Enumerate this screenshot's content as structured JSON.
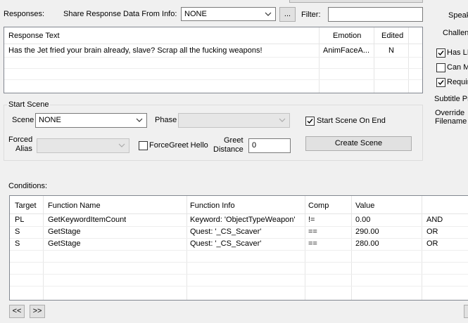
{
  "top": {
    "responses_label": "Responses:",
    "share_label": "Share Response Data From Info:",
    "share_value": "NONE",
    "ellipsis_label": "...",
    "filter_label": "Filter:",
    "filter_value": ""
  },
  "responses_table": {
    "columns": [
      "Response Text",
      "Emotion",
      "Edited"
    ],
    "rows": [
      {
        "text": "Has the Jet fried your brain already, slave? Scrap all the fucking weapons!",
        "emotion": "AnimFaceA...",
        "edited": "N"
      }
    ]
  },
  "start_scene": {
    "group_title": "Start Scene",
    "scene_label": "Scene",
    "scene_value": "NONE",
    "phase_label": "Phase",
    "phase_value": "",
    "start_scene_on_end_label": "Start Scene On End",
    "start_scene_on_end_checked": true,
    "forced_alias_label_1": "Forced",
    "forced_alias_label_2": "Alias",
    "forced_alias_value": "",
    "forcegreet_label": "ForceGreet Hello",
    "forcegreet_checked": false,
    "greet_label_1": "Greet",
    "greet_label_2": "Distance",
    "greet_value": "0",
    "create_scene_label": "Create Scene"
  },
  "conditions": {
    "label": "Conditions:",
    "columns": [
      "Target",
      "Function Name",
      "Function Info",
      "Comp",
      "Value",
      ""
    ],
    "rows": [
      {
        "target": "PL",
        "function": "GetKeywordItemCount",
        "info": "Keyword: 'ObjectTypeWeapon'",
        "comp": "!=",
        "value": "0.00",
        "op": "AND"
      },
      {
        "target": "S",
        "function": "GetStage",
        "info": "Quest: '_CS_Scaver'",
        "comp": "==",
        "value": "290.00",
        "op": "OR"
      },
      {
        "target": "S",
        "function": "GetStage",
        "info": "Quest: '_CS_Scaver'",
        "comp": "==",
        "value": "280.00",
        "op": "OR"
      }
    ]
  },
  "nav": {
    "prev_label": "<<",
    "next_label": ">>"
  },
  "right_panel": {
    "speak_label": "Speak",
    "challenge_label": "Challeng",
    "has_li_label": "Has LI",
    "has_li_checked": true,
    "can_m_label": "Can M",
    "can_m_checked": false,
    "requir_label": "Requir",
    "requir_checked": true,
    "subtitle_label": "Subtitle Pr",
    "override_label": "Override",
    "filename_label": "Filename"
  }
}
